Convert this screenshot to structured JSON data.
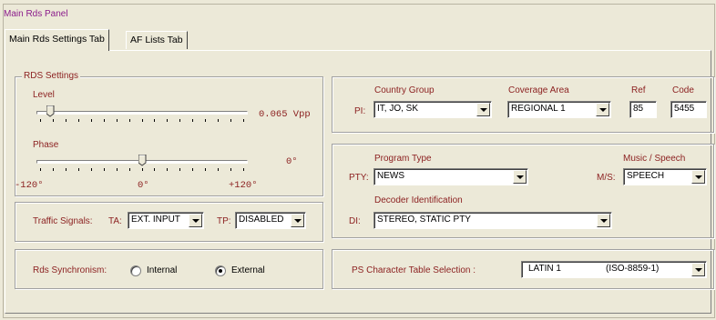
{
  "panel_title": "Main Rds Panel",
  "tabs": [
    "Main Rds Settings Tab",
    "AF Lists Tab"
  ],
  "rds_settings": {
    "legend": "RDS Settings",
    "level": {
      "label": "Level",
      "value_text": "0.065 Vpp",
      "fraction": 0.05
    },
    "phase": {
      "label": "Phase",
      "value_text": "0°",
      "fraction": 0.5,
      "ticks": [
        "-120°",
        "0°",
        "+120°"
      ]
    }
  },
  "traffic": {
    "label": "Traffic Signals:",
    "ta_label": "TA:",
    "ta_value": "EXT. INPUT",
    "tp_label": "TP:",
    "tp_value": "DISABLED"
  },
  "sync": {
    "label": "Rds Synchronism:",
    "options": [
      "Internal",
      "External"
    ],
    "selected": "External"
  },
  "pi": {
    "row_label": "PI:",
    "country_group_label": "Country Group",
    "country_group_value": "IT, JO, SK",
    "coverage_area_label": "Coverage Area",
    "coverage_area_value": "REGIONAL 1",
    "ref_label": "Ref",
    "ref_value": "85",
    "code_label": "Code",
    "code_value": "5455"
  },
  "pty": {
    "program_type_label": "Program Type",
    "row_label": "PTY:",
    "program_type_value": "NEWS",
    "ms_header": "Music / Speech",
    "ms_label": "M/S:",
    "ms_value": "SPEECH",
    "di_header": "Decoder Identification",
    "di_label": "DI:",
    "di_value": "STEREO, STATIC PTY"
  },
  "ps": {
    "label": "PS Character Table Selection :",
    "value_name": "LATIN 1",
    "value_code": "(ISO-8859-1)"
  },
  "colors": {
    "label_red": "#8b1f1f",
    "title_purple": "#8b1c8b",
    "background": "#ece9d8"
  }
}
